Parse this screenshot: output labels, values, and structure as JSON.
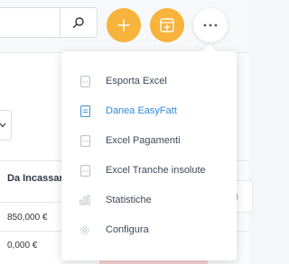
{
  "toolbar": {
    "search_icon": "search-icon",
    "add_icon": "plus-icon",
    "add_doc_icon": "add-document-icon",
    "more_icon": "more-horizontal-icon",
    "accent_color": "#f7b33b"
  },
  "table": {
    "column_header": "Da Incassare",
    "rows": [
      {
        "value": "850,000 €"
      },
      {
        "value": "0,000 €"
      }
    ]
  },
  "dropdown": {
    "items": [
      {
        "label": "Esporta Excel",
        "icon": "excel-file-icon",
        "active": false
      },
      {
        "label": "Danea EasyFatt",
        "icon": "file-icon",
        "active": true
      },
      {
        "label": "Excel Pagamenti",
        "icon": "excel-file-icon",
        "active": false
      },
      {
        "label": "Excel Tranche insolute",
        "icon": "excel-file-icon",
        "active": false
      },
      {
        "label": "Statistiche",
        "icon": "bar-chart-icon",
        "active": false
      },
      {
        "label": "Configura",
        "icon": "gear-icon",
        "active": false
      }
    ],
    "active_color": "#2e8ad8"
  },
  "side_card": {
    "icon": "info-icon"
  }
}
